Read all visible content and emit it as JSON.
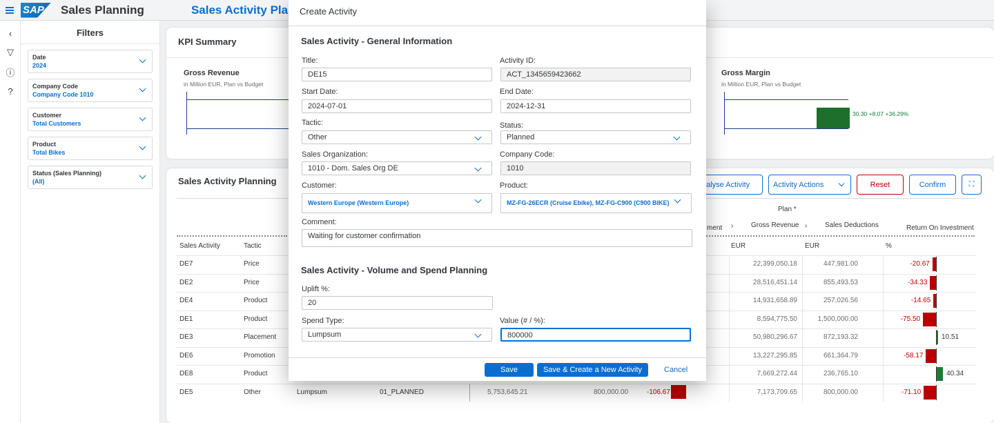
{
  "shell": {
    "app_title": "Sales Planning",
    "page_title": "Sales Activity Planning",
    "logo": "SAP"
  },
  "filters": {
    "title": "Filters",
    "items": [
      {
        "label": "Date",
        "value": "2024"
      },
      {
        "label": "Company Code",
        "value": "Company Code 1010"
      },
      {
        "label": "Customer",
        "value": "Total Customers"
      },
      {
        "label": "Product",
        "value": "Total Bikes"
      },
      {
        "label": "Status (Sales Planning)",
        "value": "(All)"
      }
    ]
  },
  "kpi": {
    "title": "KPI Summary",
    "tiles": [
      {
        "title": "Gross Revenue",
        "subtitle": "in Million EUR, Plan vs Budget"
      },
      {
        "title": "Gross Margin",
        "subtitle": "in Million EUR, Plan vs Budget",
        "value_text": "30.30 +8.07 +36.29%"
      }
    ]
  },
  "table": {
    "title": "Sales Activity Planning",
    "buttons": {
      "analyse": "nalyse Activity",
      "actions": "Activity Actions",
      "reset": "Reset",
      "confirm": "Confirm"
    },
    "plan_header": "Plan *",
    "col_headers": {
      "activity": "Sales Activity",
      "tactic": "Tactic",
      "partial": "ment",
      "gross_revenue": "Gross Revenue",
      "sales_deductions": "Sales Deductions",
      "roi": "Return On Investment"
    },
    "units": {
      "gr": "EUR",
      "sd": "EUR",
      "roi": "%"
    },
    "rows": [
      {
        "activity": "DE7",
        "tactic": "Price",
        "gr": "22,399,050.18",
        "sd": "447,981.00",
        "roi": "-20.67"
      },
      {
        "activity": "DE2",
        "tactic": "Price",
        "gr": "28,516,451.14",
        "sd": "855,493.53",
        "roi": "-34.33"
      },
      {
        "activity": "DE4",
        "tactic": "Product",
        "gr": "14,931,658.89",
        "sd": "257,026.56",
        "roi": "-14.65"
      },
      {
        "activity": "DE1",
        "tactic": "Product",
        "gr": "8,594,775.50",
        "sd": "1,500,000.00",
        "roi": "-75.50"
      },
      {
        "activity": "DE3",
        "tactic": "Placement",
        "gr": "50,980,296.67",
        "sd": "872,193.32",
        "roi": "10.51"
      },
      {
        "activity": "DE6",
        "tactic": "Promotion",
        "gr": "13,227,295.85",
        "sd": "661,364.79",
        "roi": "-58.17"
      },
      {
        "activity": "DE8",
        "tactic": "Product",
        "gr": "7,669,272.44",
        "sd": "236,765.10",
        "roi": "40.34"
      },
      {
        "activity": "DE5",
        "tactic": "Other",
        "gr": "7,173,709.65",
        "sd": "800,000.00",
        "roi": "-71.10"
      }
    ],
    "de5_extra": {
      "spend_type": "Lumpsum",
      "status": "01_PLANNED",
      "c1": "5,753,645.21",
      "c2": "800,000.00",
      "c3": "-106.67"
    }
  },
  "dialog": {
    "title": "Create Activity",
    "section1": "Sales Activity - General Information",
    "section2": "Sales Activity - Volume and Spend Planning",
    "labels": {
      "title": "Title:",
      "activity_id": "Activity ID:",
      "start_date": "Start Date:",
      "end_date": "End Date:",
      "tactic": "Tactic:",
      "status": "Status:",
      "sales_org": "Sales Organization:",
      "company_code": "Company Code:",
      "customer": "Customer:",
      "product": "Product:",
      "comment": "Comment:",
      "uplift": "Uplift %:",
      "spend_type": "Spend Type:",
      "value": "Value (# / %):"
    },
    "values": {
      "title": "DE15",
      "activity_id": "ACT_1345659423662",
      "start_date": "2024-07-01",
      "end_date": "2024-12-31",
      "tactic": "Other",
      "status": "Planned",
      "sales_org": "1010 - Dom. Sales Org DE",
      "company_code": "1010",
      "customer": "Western Europe (Western Europe)",
      "product": "MZ-FG-26ECR (Cruise Ebike), MZ-FG-C900 (C900 BIKE)",
      "comment": "Waiting for customer confirmation",
      "uplift": "20",
      "spend_type": "Lumpsum",
      "value": "800000"
    },
    "buttons": {
      "save": "Save",
      "save_new": "Save & Create a New Activity",
      "cancel": "Cancel"
    }
  },
  "colors": {
    "accent": "#0a6ed1",
    "negative": "#bb0000",
    "positive": "#107e3e"
  }
}
